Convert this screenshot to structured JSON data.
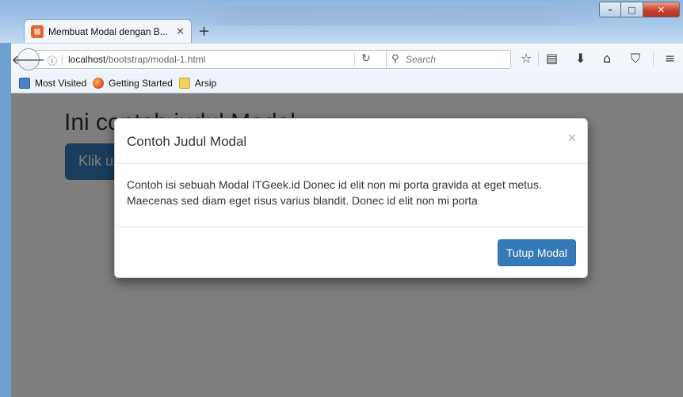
{
  "browser": {
    "tab": {
      "title": "Membuat Modal dengan B...",
      "favicon": "xampp-icon"
    },
    "url": {
      "host": "localhost",
      "path": "/bootstrap/modal-1.html"
    },
    "search": {
      "placeholder": "Search"
    },
    "window_controls": {
      "minimize": "–",
      "maximize": "□",
      "close": "✕"
    }
  },
  "bookmarks": [
    {
      "label": "Most Visited",
      "icon": "most-visited-icon"
    },
    {
      "label": "Getting Started",
      "icon": "firefox-icon"
    },
    {
      "label": "Arsip",
      "icon": "folder-icon"
    }
  ],
  "page": {
    "heading": "Ini contoh judul Modal",
    "button": "Klik untuk Modal"
  },
  "modal": {
    "title": "Contoh Judul Modal",
    "close": "×",
    "body": "Contoh isi sebuah Modal ITGeek.id Donec id elit non mi porta gravida at eget metus. Maecenas sed diam eget risus varius blandit. Donec id elit non mi porta",
    "button": "Tutup Modal"
  },
  "colors": {
    "primary": "#337ab7",
    "backdrop": "rgba(0,0,0,0.5)"
  }
}
